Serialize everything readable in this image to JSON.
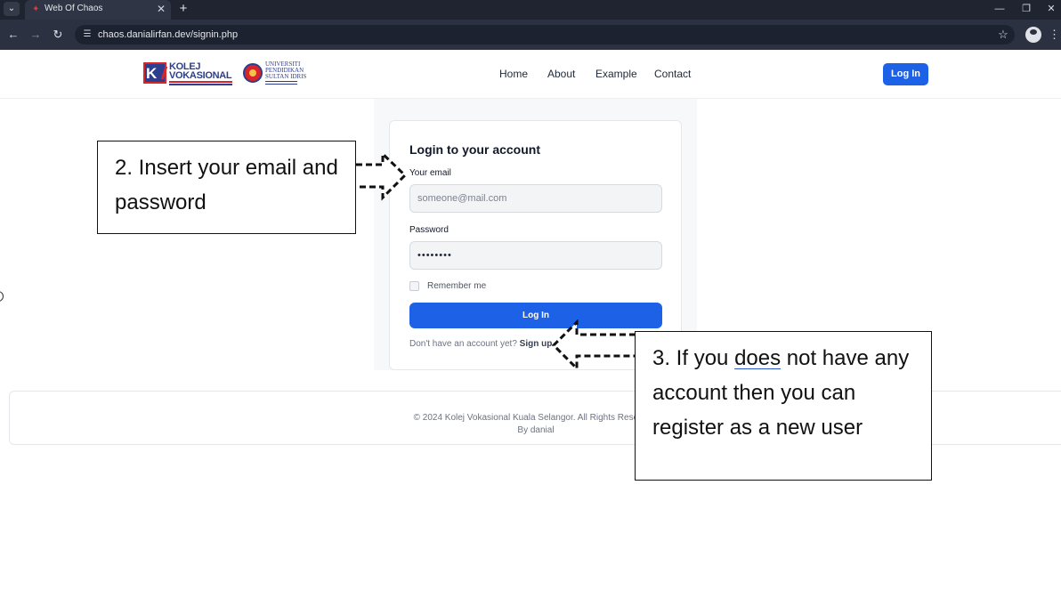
{
  "browser": {
    "tab_title": "Web Of Chaos",
    "url": "chaos.danialirfan.dev/signin.php",
    "icons": [
      "tab-search-icon",
      "favicon-icon",
      "close-icon",
      "plus-icon",
      "minimize-icon",
      "restore-icon",
      "close-window-icon",
      "back-icon",
      "forward-icon",
      "reload-icon",
      "site-info-icon",
      "star-icon",
      "profile-icon",
      "menu-icon"
    ]
  },
  "header": {
    "logo_kv_line1": "KOLEJ",
    "logo_kv_line2": "VOKASIONAL",
    "logo_upsi_line1": "UNIVERSITI",
    "logo_upsi_line2": "PENDIDIKAN",
    "logo_upsi_line3": "SULTAN IDRIS",
    "nav": [
      "Home",
      "About",
      "Example",
      "Contact"
    ],
    "login_label": "Log In",
    "accent_color": "#1d62e6"
  },
  "login": {
    "title": "Login to your account",
    "email_label": "Your email",
    "email_placeholder": "someone@mail.com",
    "password_label": "Password",
    "password_value": "••••••••",
    "remember_label": "Remember me",
    "remember_checked": false,
    "submit_label": "Log In",
    "signup_prompt": "Don't have an account yet?",
    "signup_link": "Sign up"
  },
  "footer": {
    "copyright": "© 2024 Kolej Vokasional Kuala Selangor. All Rights Reserved.",
    "byline": "By danial"
  },
  "annotations": {
    "note2": "2. Insert your email and password",
    "note3_before": "3. If you ",
    "note3_underlined": "does",
    "note3_after": " not have any account then you can register as a new user"
  }
}
